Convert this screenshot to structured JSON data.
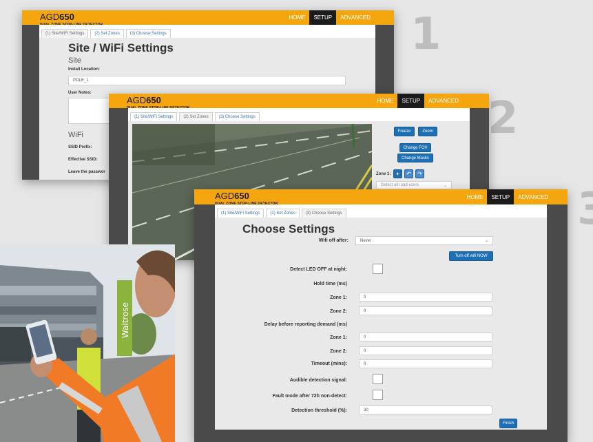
{
  "steps": [
    "1",
    "2",
    "3"
  ],
  "brand": {
    "agd": "AGD",
    "model": "650",
    "subtitle": "DUAL ZONE STOP-LINE DETECTOR"
  },
  "nav": {
    "home": "HOME",
    "setup": "SETUP",
    "advanced": "ADVANCED"
  },
  "tabs": [
    "(1) Site/WiFi Settings",
    "(2) Set Zones",
    "(3) Choose Settings"
  ],
  "window1": {
    "title": "Site / WiFi Settings",
    "site_heading": "Site",
    "install_location_label": "Install Location:",
    "install_location_value": "POLE_1",
    "user_notes_label": "User Notes:",
    "wifi_heading": "WiFi",
    "ssid_prefix_label": "SSID Prefix:",
    "effective_ssid_label": "Effective SSID:",
    "leave_password_text": "Leave the passwor"
  },
  "window2": {
    "freeze": "Freeze",
    "zoom": "Zoom",
    "change_fov": "Change FOV",
    "change_masks": "Change Masks",
    "zone_label": "Zone 1:",
    "add_glyph": "+",
    "undo_glyph": "↶",
    "redo_glyph": "↷",
    "detect_select": "Detect all road-users"
  },
  "window3": {
    "title": "Choose Settings",
    "wifi_off_after_label": "Wifi off after:",
    "wifi_off_after_value": "Never",
    "turn_off_wifi": "Turn off wifi NOW",
    "detect_led_off": "Detect LED OFF at night:",
    "hold_time": "Hold time (ms)",
    "zone1": "Zone 1:",
    "zone1_value": "0",
    "zone2": "Zone 2:",
    "zone2_value": "0",
    "delay_before": "Delay before reporting demand (ms)",
    "delay_zone1_value": "0",
    "delay_zone2_value": "0",
    "timeout": "Timeout (mins):",
    "timeout_value": "0",
    "audible": "Audible detection signal:",
    "fault_mode": "Fault mode after 72h non-detect:",
    "threshold": "Detection threshold (%):",
    "threshold_value": "30",
    "finish": "Finish"
  },
  "photo": {
    "store_sign": "Waitrose"
  },
  "colors": {
    "brand_orange": "#f5a50d",
    "button_blue": "#1f6fb5",
    "nav_active": "#1c1c1c"
  }
}
